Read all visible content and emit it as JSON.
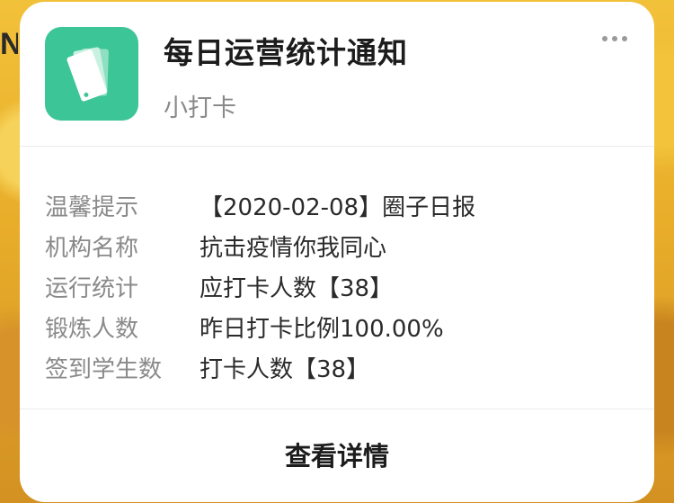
{
  "card": {
    "title": "每日运营统计通知",
    "source": "小打卡",
    "fields": [
      {
        "label": "温馨提示",
        "value": "【2020-02-08】圈子日报"
      },
      {
        "label": "机构名称",
        "value": "抗击疫情你我同心"
      },
      {
        "label": "运行统计",
        "value": "应打卡人数【38】"
      },
      {
        "label": "锻炼人数",
        "value": "昨日打卡比例100.00%"
      },
      {
        "label": "签到学生数",
        "value": "打卡人数【38】"
      }
    ],
    "action_label": "查看详情"
  },
  "background": {
    "edge_text": "N"
  },
  "icons": {
    "app": "cards-icon",
    "menu": "more-icon"
  },
  "colors": {
    "app_icon_bg": "#3cc596",
    "card_bg": "#ffffff",
    "label": "#8a8a8a",
    "value": "#2a2a2a"
  }
}
